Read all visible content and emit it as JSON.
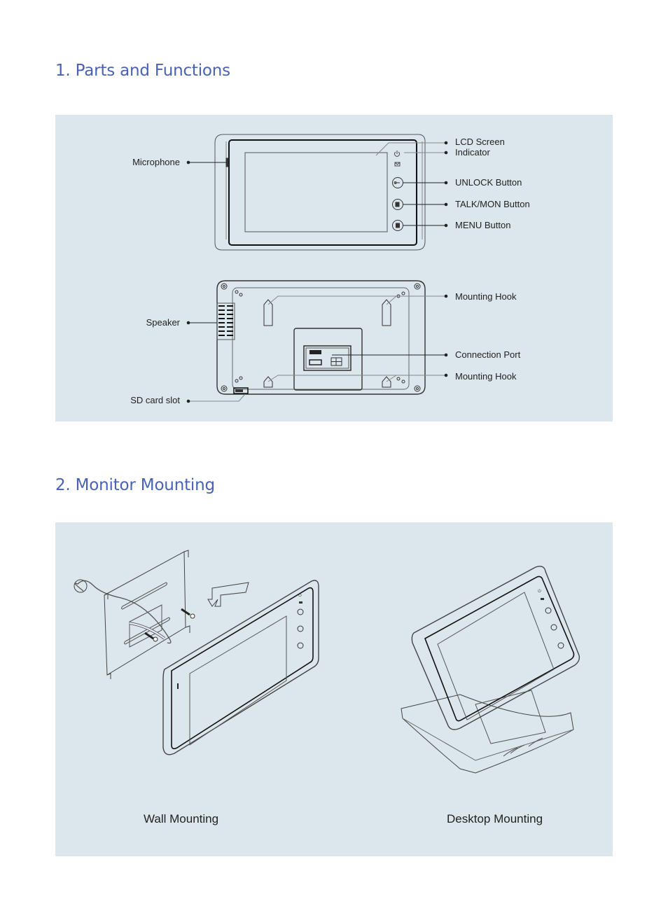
{
  "sections": [
    {
      "title": "1. Parts and Functions",
      "front_labels": {
        "microphone": "Microphone",
        "lcd_screen": "LCD Screen",
        "indicator": "Indicator",
        "unlock_button": "UNLOCK Button",
        "talk_mon_button": "TALK/MON Button",
        "menu_button": "MENU Button"
      },
      "back_labels": {
        "speaker": "Speaker",
        "sd_card_slot": "SD card slot",
        "mounting_hook_top": "Mounting Hook",
        "connection_port": "Connection Port",
        "mounting_hook_bottom": "Mounting Hook"
      },
      "icons": {
        "indicator_power": "power-icon",
        "indicator_message": "envelope-icon",
        "unlock": "key-icon",
        "talk_mon": "handset-icon",
        "menu": "menu-icon"
      }
    },
    {
      "title": "2. Monitor Mounting",
      "captions": {
        "wall": "Wall Mounting",
        "desktop": "Desktop Mounting"
      }
    }
  ],
  "colors": {
    "title": "#4a62b4",
    "panel_background": "#dce6ed",
    "line_art": "#333333"
  }
}
